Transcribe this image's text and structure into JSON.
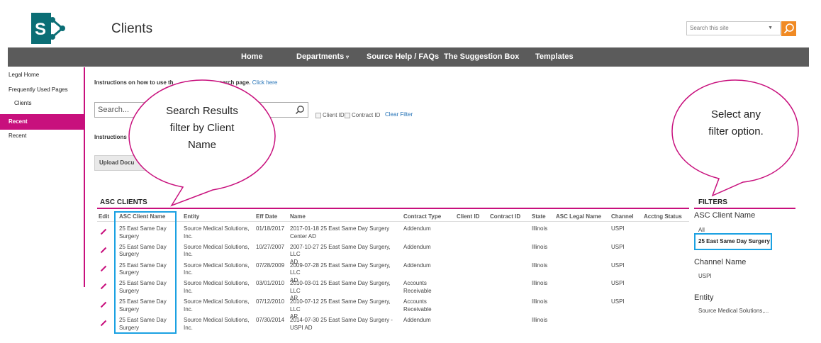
{
  "site": {
    "title": "Clients",
    "search_placeholder": "Search this site",
    "search_dropdown": "▼"
  },
  "topnav": {
    "items": [
      "Home",
      "Departments",
      "Source Help / FAQs",
      "The Suggestion Box",
      "Templates"
    ],
    "dropdown_marker": "▿"
  },
  "leftnav": {
    "items": [
      "Legal Home",
      "Frequently Used Pages",
      "Clients",
      "Recent",
      "Recent"
    ]
  },
  "main": {
    "instructions_search": "Instructions on how to use th",
    "instructions_search_hidden": "search page.",
    "click_here": "Click here",
    "search_placeholder": "Search...",
    "checkbox_client_id": "Client ID",
    "checkbox_contract_id": "Contract ID",
    "clear_filter": "Clear Filter",
    "instructions_upload": "Instructions",
    "upload_button": "Upload Docu"
  },
  "results": {
    "title": "ASC CLIENTS",
    "columns": [
      "Edit",
      "ASC Client Name",
      "Entity",
      "Eff Date",
      "Name",
      "Contract Type",
      "Client ID",
      "Contract ID",
      "State",
      "ASC Legal Name",
      "Channel",
      "Acctng Status"
    ],
    "rows": [
      {
        "client": [
          "25 East Same Day",
          "Surgery"
        ],
        "entity": [
          "Source Medical Solutions,",
          "Inc."
        ],
        "eff_date": "01/18/2017",
        "name": [
          "2017-01-18 25 East Same Day Surgery",
          "Center AD"
        ],
        "contract_type": [
          "Addendum"
        ],
        "state": "Illinois",
        "channel": "USPI"
      },
      {
        "client": [
          "25 East Same Day",
          "Surgery"
        ],
        "entity": [
          "Source Medical Solutions,",
          "Inc."
        ],
        "eff_date": "10/27/2007",
        "name": [
          "2007-10-27 25 East Same Day Surgery, LLC",
          "AD"
        ],
        "contract_type": [
          "Addendum"
        ],
        "state": "Illinois",
        "channel": "USPI"
      },
      {
        "client": [
          "25 East Same Day",
          "Surgery"
        ],
        "entity": [
          "Source Medical Solutions,",
          "Inc."
        ],
        "eff_date": "07/28/2009",
        "name": [
          "2009-07-28 25 East Same Day Surgery, LLC",
          "AD"
        ],
        "contract_type": [
          "Addendum"
        ],
        "state": "Illinois",
        "channel": "USPI"
      },
      {
        "client": [
          "25 East Same Day",
          "Surgery"
        ],
        "entity": [
          "Source Medical Solutions,",
          "Inc."
        ],
        "eff_date": "03/01/2010",
        "name": [
          "2010-03-01 25 East Same Day Surgery, LLC",
          "AR"
        ],
        "contract_type": [
          "Accounts",
          "Receivable"
        ],
        "state": "Illinois",
        "channel": "USPI"
      },
      {
        "client": [
          "25 East Same Day",
          "Surgery"
        ],
        "entity": [
          "Source Medical Solutions,",
          "Inc."
        ],
        "eff_date": "07/12/2010",
        "name": [
          "2010-07-12 25 East Same Day Surgery, LLC",
          "AR"
        ],
        "contract_type": [
          "Accounts",
          "Receivable"
        ],
        "state": "Illinois",
        "channel": "USPI"
      },
      {
        "client": [
          "25 East Same Day",
          "Surgery"
        ],
        "entity": [
          "Source Medical Solutions,",
          "Inc."
        ],
        "eff_date": "07/30/2014",
        "name": [
          "2014-07-30 25 East Same Day Surgery -",
          "USPI AD"
        ],
        "contract_type": [
          "Addendum"
        ],
        "state": "Illinois",
        "channel": ""
      }
    ]
  },
  "filters": {
    "title": "FILTERS",
    "client_heading": "ASC Client Name",
    "client_options": [
      "All",
      "25 East Same Day Surgery"
    ],
    "channel_heading": "Channel Name",
    "channel_options": [
      "USPI"
    ],
    "entity_heading": "Entity",
    "entity_options": [
      "Source Medical Solutions,..."
    ]
  },
  "callouts": {
    "left": [
      "Search Results",
      "filter by Client",
      "Name"
    ],
    "right": [
      "Select any",
      "filter option."
    ]
  },
  "colors": {
    "accent": "#c8107d",
    "nav_bg": "#5b5b5b",
    "highlight": "#1ba1e2",
    "search_button": "#f08a24",
    "link": "#1f6fb5"
  }
}
